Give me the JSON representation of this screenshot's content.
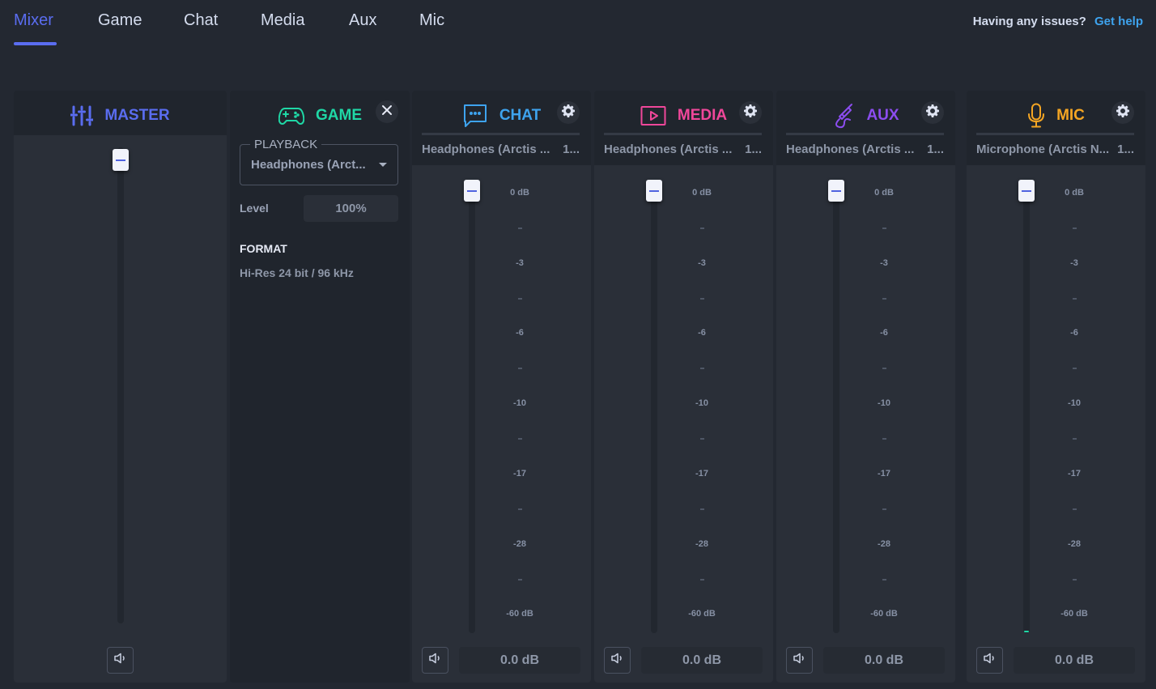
{
  "nav": {
    "tabs": [
      {
        "label": "Mixer",
        "active": true
      },
      {
        "label": "Game",
        "active": false
      },
      {
        "label": "Chat",
        "active": false
      },
      {
        "label": "Media",
        "active": false
      },
      {
        "label": "Aux",
        "active": false
      },
      {
        "label": "Mic",
        "active": false
      }
    ],
    "help_question": "Having any issues?",
    "help_link": "Get help"
  },
  "colors": {
    "accent": "#5a6df0",
    "master": "#5a6df0",
    "game": "#1fd8a6",
    "chat": "#3ea3ee",
    "media": "#f0479a",
    "aux": "#8c4df0",
    "mic": "#f5a623",
    "help_link": "#3ea3ee"
  },
  "master": {
    "title": "MASTER",
    "icon": "sliders-icon",
    "fader_level": 1.0,
    "mute_icon": "speaker-icon"
  },
  "game": {
    "title": "GAME",
    "icon": "gamepad-icon",
    "close_icon": "close-icon",
    "playback_label": "PLAYBACK",
    "playback_value": "Headphones (Arct...",
    "level_label": "Level",
    "level_value": "100%",
    "format_title": "FORMAT",
    "format_value": "Hi-Res 24 bit / 96 kHz"
  },
  "scale_labels": [
    "0 dB",
    "-3",
    "-6",
    "-10",
    "-17",
    "-28",
    "-60 dB"
  ],
  "channels": [
    {
      "key": "chat",
      "title": "CHAT",
      "icon": "chat-bubble-icon",
      "device": "Headphones (Arctis ...",
      "device_suffix": "1...",
      "fader_level": 1.0,
      "db_value": "0.0 dB",
      "meter": false
    },
    {
      "key": "media",
      "title": "MEDIA",
      "icon": "play-icon",
      "device": "Headphones (Arctis ...",
      "device_suffix": "1...",
      "fader_level": 1.0,
      "db_value": "0.0 dB",
      "meter": false
    },
    {
      "key": "aux",
      "title": "AUX",
      "icon": "aux-cable-icon",
      "device": "Headphones (Arctis ...",
      "device_suffix": "1...",
      "fader_level": 1.0,
      "db_value": "0.0 dB",
      "meter": false
    },
    {
      "key": "mic",
      "title": "MIC",
      "icon": "microphone-icon",
      "device": "Microphone (Arctis N...",
      "device_suffix": "1...",
      "fader_level": 1.0,
      "db_value": "0.0 dB",
      "meter": true
    }
  ]
}
